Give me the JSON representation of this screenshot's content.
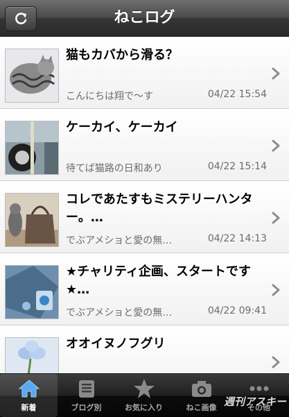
{
  "app": {
    "title": "ねこログ"
  },
  "navbar": {
    "refresh_icon": "refresh-icon"
  },
  "posts": [
    {
      "title": "猫もカバから滑る？",
      "author": "こんにちは翔で～す",
      "date": "04/22 15:54"
    },
    {
      "title": "ケーカイ、ケーカイ",
      "author": "待てば猫路の日和あり",
      "date": "04/22 15:14"
    },
    {
      "title": "コレであたすもミステリーハンター。…",
      "author": "でぶアメショと愛の無…",
      "date": "04/22 14:13"
    },
    {
      "title": "★チャリティ企画、スタートです★…",
      "author": "でぶアメショと愛の無…",
      "date": "04/22 09:41"
    },
    {
      "title": "オオイヌノフグリ",
      "author": "",
      "date": ""
    }
  ],
  "tabs": [
    {
      "label": "新着",
      "icon": "home-icon",
      "active": true
    },
    {
      "label": "ブログ別",
      "icon": "list-icon",
      "active": false
    },
    {
      "label": "お気に入り",
      "icon": "star-icon",
      "active": false
    },
    {
      "label": "ねこ画像",
      "icon": "camera-icon",
      "active": false
    },
    {
      "label": "その他",
      "icon": "more-icon",
      "active": false
    }
  ],
  "watermark": "週刊アスキー",
  "colors": {
    "navbar": "#3c3c3c",
    "tab_active": "#5aa9ef"
  }
}
